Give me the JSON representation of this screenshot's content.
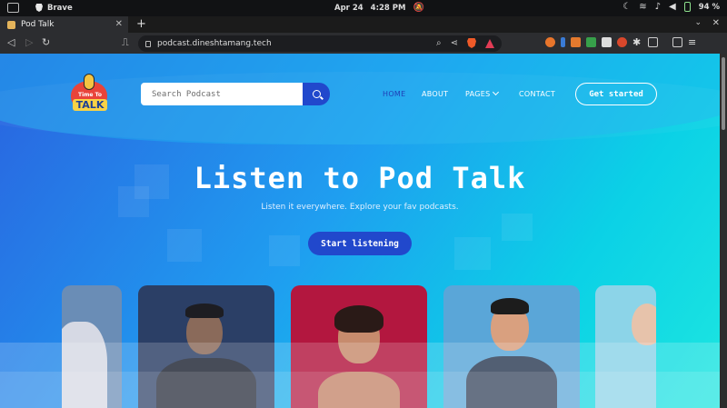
{
  "os": {
    "app_name": "Brave",
    "date": "Apr 24",
    "time": "4:28 PM",
    "battery": "94 %"
  },
  "browser": {
    "tab_title": "Pod Talk",
    "url": "podcast.dineshtamang.tech",
    "new_tab_symbol": "+",
    "close_symbol": "✕",
    "menu_symbol": "⌄"
  },
  "site": {
    "logo_top": "Time To",
    "logo_bottom": "TALK",
    "search": {
      "placeholder": "Search Podcast"
    },
    "nav": {
      "home": "HOME",
      "about": "ABOUT",
      "pages": "PAGES",
      "contact": "CONTACT"
    },
    "cta_header": "Get started",
    "hero": {
      "title": "Listen to Pod Talk",
      "subtitle": "Listen it everywhere. Explore your fav podcasts.",
      "cta": "Start listening"
    }
  },
  "colors": {
    "accent": "#2148cc",
    "nav_active": "#1f3fb7",
    "gradient_start": "#2a63e0",
    "gradient_end": "#1de6e0"
  }
}
